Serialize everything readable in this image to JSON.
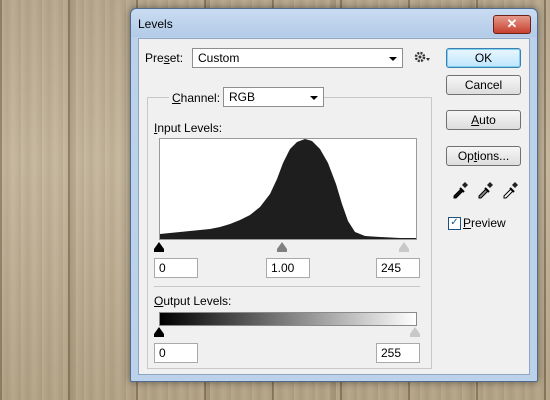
{
  "window": {
    "title": "Levels",
    "close_glyph": "✕"
  },
  "preset": {
    "label_pre": "Pre",
    "label_u": "s",
    "label_post": "et:",
    "value": "Custom",
    "options_icon": "gear-icon"
  },
  "channel": {
    "label_pre": "",
    "label_u": "C",
    "label_post": "hannel:",
    "value": "RGB"
  },
  "input_levels": {
    "label_pre": "",
    "label_u": "I",
    "label_post": "nput Levels:",
    "black": "0",
    "gamma": "1.00",
    "white": "245",
    "black_point": 0,
    "gamma_value": 1.0,
    "white_point": 245
  },
  "output_levels": {
    "label_pre": "",
    "label_u": "O",
    "label_post": "utput Levels:",
    "black": "0",
    "white": "255",
    "black_point": 0,
    "white_point": 255
  },
  "buttons": {
    "ok": "OK",
    "cancel": "Cancel",
    "auto_pre": "",
    "auto_u": "A",
    "auto_post": "uto",
    "options_pre": "Op",
    "options_u": "t",
    "options_post": "ions..."
  },
  "preview": {
    "label_pre": "",
    "label_u": "P",
    "label_post": "review",
    "checked": true,
    "check_glyph": "✓"
  },
  "eyedroppers": [
    "black-eyedropper-icon",
    "gray-eyedropper-icon",
    "white-eyedropper-icon"
  ],
  "colors": {
    "accent": "#3c7fb1",
    "title_bar": "#bcd1ea",
    "close": "#c84030"
  }
}
